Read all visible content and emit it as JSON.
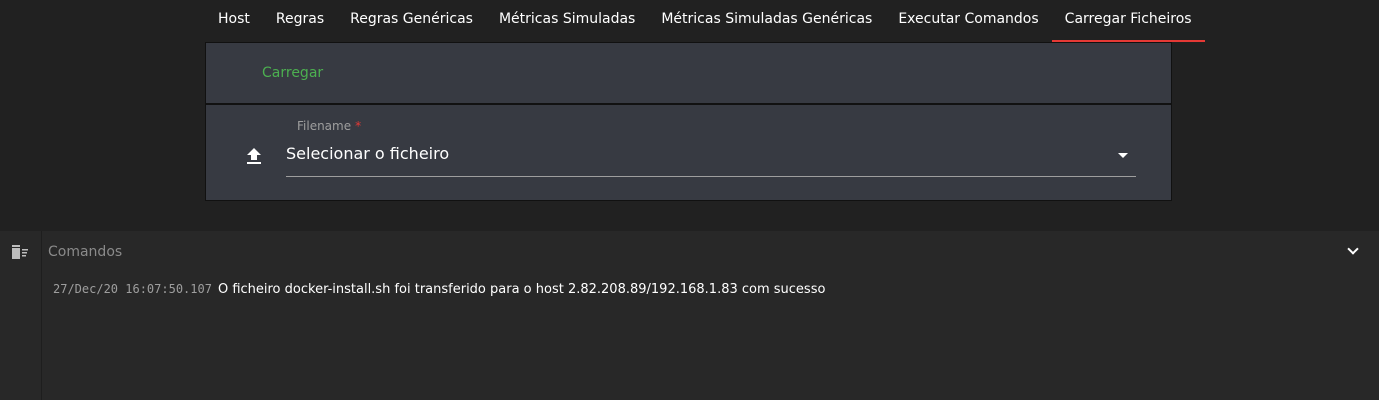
{
  "tabs": [
    {
      "label": "Host"
    },
    {
      "label": "Regras"
    },
    {
      "label": "Regras Genéricas"
    },
    {
      "label": "Métricas Simuladas"
    },
    {
      "label": "Métricas Simuladas Genéricas"
    },
    {
      "label": "Executar Comandos"
    },
    {
      "label": "Carregar Ficheiros",
      "active": true
    }
  ],
  "upload": {
    "button_label": "Carregar",
    "field_label": "Filename",
    "required_mark": "*",
    "selected_value": "Selecionar o ficheiro",
    "icon": "upload-icon"
  },
  "console": {
    "title": "Comandos",
    "icon": "clear-log-icon",
    "entries": [
      {
        "timestamp": "27/Dec/20 16:07:50.107",
        "message": "O ficheiro docker-install.sh foi transferido para o host 2.82.208.89/192.168.1.83 com sucesso"
      }
    ]
  },
  "colors": {
    "accent_active_tab": "#e53935",
    "button": "#4caf50"
  }
}
